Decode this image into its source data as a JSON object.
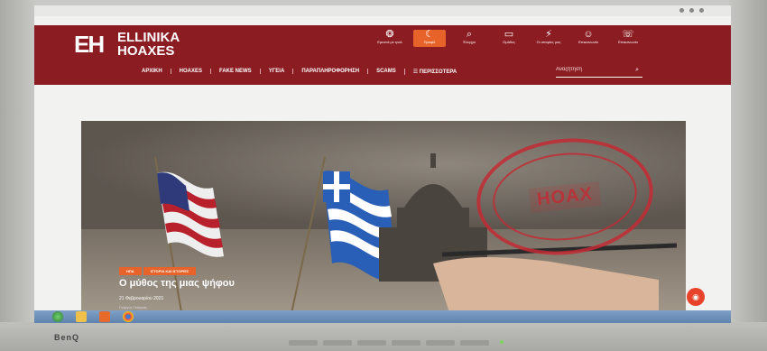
{
  "monitor": {
    "brand": "BenQ"
  },
  "site": {
    "logo_mark": "EH",
    "logo_line1": "ELLINIKA",
    "logo_line2": "HOAXES"
  },
  "header_icons": [
    {
      "icon": "brain-icon",
      "glyph": "❂",
      "label": "Ερευνά με τρολ"
    },
    {
      "icon": "heart-icon",
      "glyph": "☾",
      "label": "Προφίλ"
    },
    {
      "icon": "search-icon",
      "glyph": "⌕",
      "label": "Έλεγχοι"
    },
    {
      "icon": "chat-icon",
      "glyph": "▭",
      "label": "Ομάδες"
    },
    {
      "icon": "bolt-icon",
      "glyph": "⚡",
      "label": "Οι ιστορίες μας"
    },
    {
      "icon": "user-icon",
      "glyph": "☺",
      "label": "Επικοινωνία"
    },
    {
      "icon": "phone-icon",
      "glyph": "☏",
      "label": "Επικοινωνία"
    }
  ],
  "nav": [
    {
      "label": "ΑΡΧΙΚΗ"
    },
    {
      "label": "HOAXES"
    },
    {
      "label": "FAKE NEWS"
    },
    {
      "label": "ΥΓΕΙΑ"
    },
    {
      "label": "ΠΑΡΑΠΛΗΡΟΦΟΡΗΣΗ"
    },
    {
      "label": "SCAMS"
    },
    {
      "label": "☰ ΠΕΡΙΣΣΟΤΕΡΑ"
    }
  ],
  "search": {
    "placeholder": "Αναζήτηση"
  },
  "hero": {
    "stamp_text": "HOAX",
    "tags": [
      "ΗΠΑ",
      "ΙΣΤΟΡΙΑ ΚΑΙ ΙΣΤΟΡΙΕΣ"
    ],
    "title": "Ο μύθος της μιας ψήφου",
    "date": "21 Φεβρουαρίου 2021",
    "author": "Γιώργος Γκιόγκας"
  },
  "colors": {
    "header_bg": "#8a1c22",
    "accent": "#e8632a",
    "stamp": "#c32b34"
  }
}
